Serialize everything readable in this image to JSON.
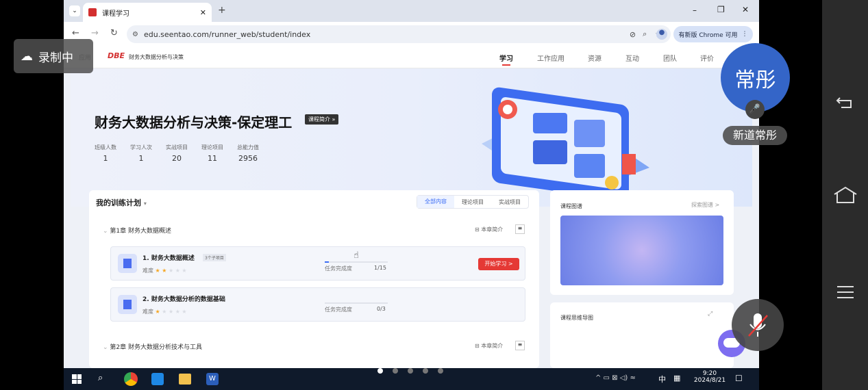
{
  "recording": {
    "label": "录制中"
  },
  "browser": {
    "tab_title": "课程学习",
    "new_tab": "+",
    "url": "edu.seentao.com/runner_web/student/index",
    "update_label": "有新版 Chrome 可用",
    "window_controls": [
      "–",
      "❐",
      "✕"
    ]
  },
  "site": {
    "logo": "DBE",
    "course_short": "财务大数据分析与决策",
    "left_crumb": "应用",
    "nav": [
      "学习",
      "工作应用",
      "资源",
      "互动",
      "团队",
      "评价"
    ]
  },
  "hero": {
    "title": "财务大数据分析与决策-保定理工",
    "intro_btn": "课程简介 »",
    "stats": [
      {
        "label": "班级人数",
        "value": "1"
      },
      {
        "label": "学习人次",
        "value": "1"
      },
      {
        "label": "实战项目",
        "value": "20"
      },
      {
        "label": "理论项目",
        "value": "11"
      },
      {
        "label": "总能力值",
        "value": "2956"
      }
    ]
  },
  "plan": {
    "title": "我的训练计划",
    "filters": [
      "全部内容",
      "理论项目",
      "实战项目"
    ],
    "chapters": [
      {
        "title": "第1章 财务大数据概述",
        "intro": "本章简介"
      },
      {
        "title": "第2章 财务大数据分析技术与工具",
        "intro": "本章简介"
      }
    ],
    "items": [
      {
        "title": "1. 财务大数据概述",
        "badge": "3个子项目",
        "difficulty_label": "难度",
        "stars": 2,
        "progress_label": "任务完成度",
        "progress": "1/15",
        "progress_fraction": 0.067,
        "action": "开始学习 >"
      },
      {
        "title": "2. 财务大数据分析的数据基础",
        "badge": "",
        "difficulty_label": "难度",
        "stars": 1,
        "progress_label": "任务完成度",
        "progress": "0/3",
        "progress_fraction": 0,
        "action": ""
      }
    ]
  },
  "side": {
    "map_title": "课程图谱",
    "map_link": "探索图谱 >",
    "mindmap_title": "课程思维导图"
  },
  "meeting": {
    "avatar_text": "常彤",
    "name": "新道常彤"
  },
  "taskbar": {
    "time": "9:20",
    "date": "2024/8/21",
    "ime": "中"
  },
  "colors": {
    "accent": "#e53935",
    "primary": "#3b6cf5",
    "taskbar": "#0f1a2b"
  }
}
